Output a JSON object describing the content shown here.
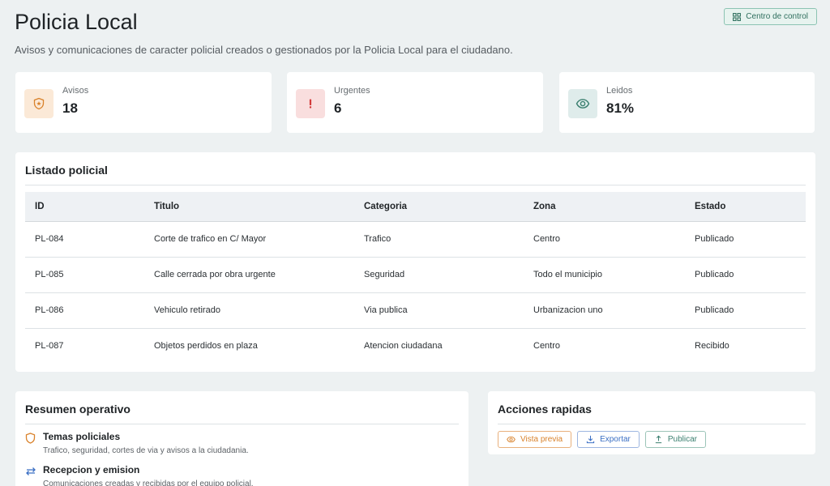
{
  "header": {
    "title": "Policia Local",
    "subtitle": "Avisos y comunicaciones de caracter policial creados o gestionados por la Policia Local para el ciudadano.",
    "control_button": "Centro de control"
  },
  "stats": [
    {
      "label": "Avisos",
      "value": "18",
      "icon": "shield-star-icon",
      "icon_bg": "#fbe9d7",
      "icon_color": "#d9822b"
    },
    {
      "label": "Urgentes",
      "value": "6",
      "icon": "exclamation-icon",
      "icon_bg": "#f9dede",
      "icon_color": "#d33b3b"
    },
    {
      "label": "Leidos",
      "value": "81%",
      "icon": "eye-icon",
      "icon_bg": "#dfeceb",
      "icon_color": "#3a7f6f"
    }
  ],
  "listado": {
    "title": "Listado policial",
    "columns": [
      "ID",
      "Titulo",
      "Categoria",
      "Zona",
      "Estado"
    ],
    "rows": [
      [
        "PL-084",
        "Corte de trafico en C/ Mayor",
        "Trafico",
        "Centro",
        "Publicado"
      ],
      [
        "PL-085",
        "Calle cerrada por obra urgente",
        "Seguridad",
        "Todo el municipio",
        "Publicado"
      ],
      [
        "PL-086",
        "Vehiculo retirado",
        "Via publica",
        "Urbanizacion uno",
        "Publicado"
      ],
      [
        "PL-087",
        "Objetos perdidos en plaza",
        "Atencion ciudadana",
        "Centro",
        "Recibido"
      ]
    ]
  },
  "resumen": {
    "title": "Resumen operativo",
    "items": [
      {
        "title": "Temas policiales",
        "desc": "Trafico, seguridad, cortes de via y avisos a la ciudadania.",
        "icon": "shield-icon"
      },
      {
        "title": "Recepcion y emision",
        "desc": "Comunicaciones creadas y recibidas por el equipo policial.",
        "icon": "arrows-exchange-icon"
      }
    ]
  },
  "acciones": {
    "title": "Acciones rapidas",
    "buttons": [
      {
        "label": "Vista previa",
        "icon": "eye-icon",
        "color": "#d9822b"
      },
      {
        "label": "Exportar",
        "icon": "download-icon",
        "color": "#3b6fc4"
      },
      {
        "label": "Publicar",
        "icon": "upload-icon",
        "color": "#3a7f6f"
      }
    ]
  },
  "colors": {
    "background": "#edf1f2",
    "accent_green": "#3a7f6f"
  }
}
